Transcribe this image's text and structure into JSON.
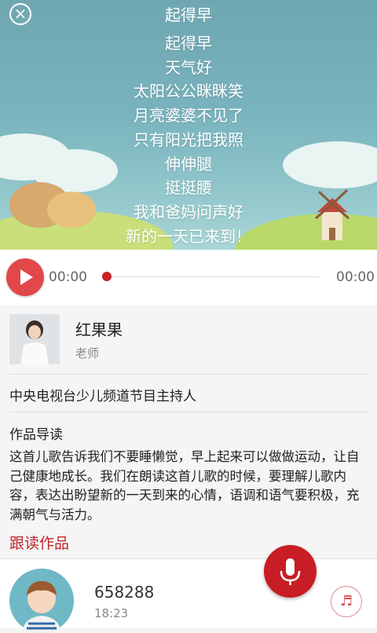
{
  "header": {
    "title": "起得早",
    "close_icon": "close-icon"
  },
  "lyrics": [
    "起得早",
    "天气好",
    "太阳公公眯眯笑",
    "月亮婆婆不见了",
    "只有阳光把我照",
    "伸伸腿",
    "挺挺腰",
    "我和爸妈问声好",
    "新的一天已来到！"
  ],
  "player": {
    "current_time": "00:00",
    "total_time": "00:00",
    "progress": 0,
    "accent_color": "#e2474a"
  },
  "teacher": {
    "name": "红果果",
    "role": "老师",
    "bio": "中央电视台少儿频道节目主持人"
  },
  "intro": {
    "heading": "作品导读",
    "text": "这首儿歌告诉我们不要睡懒觉，早上起来可以做做运动，让自己健康地成长。我们在朗读这首儿歌的时候，要理解儿歌内容，表达出盼望新的一天到来的心情，语调和语气要积极，充满朝气与活力。"
  },
  "follow": {
    "heading": "跟读作品",
    "color": "#c0262b"
  },
  "recording": {
    "user_id": "658288",
    "duration": "18:23"
  }
}
